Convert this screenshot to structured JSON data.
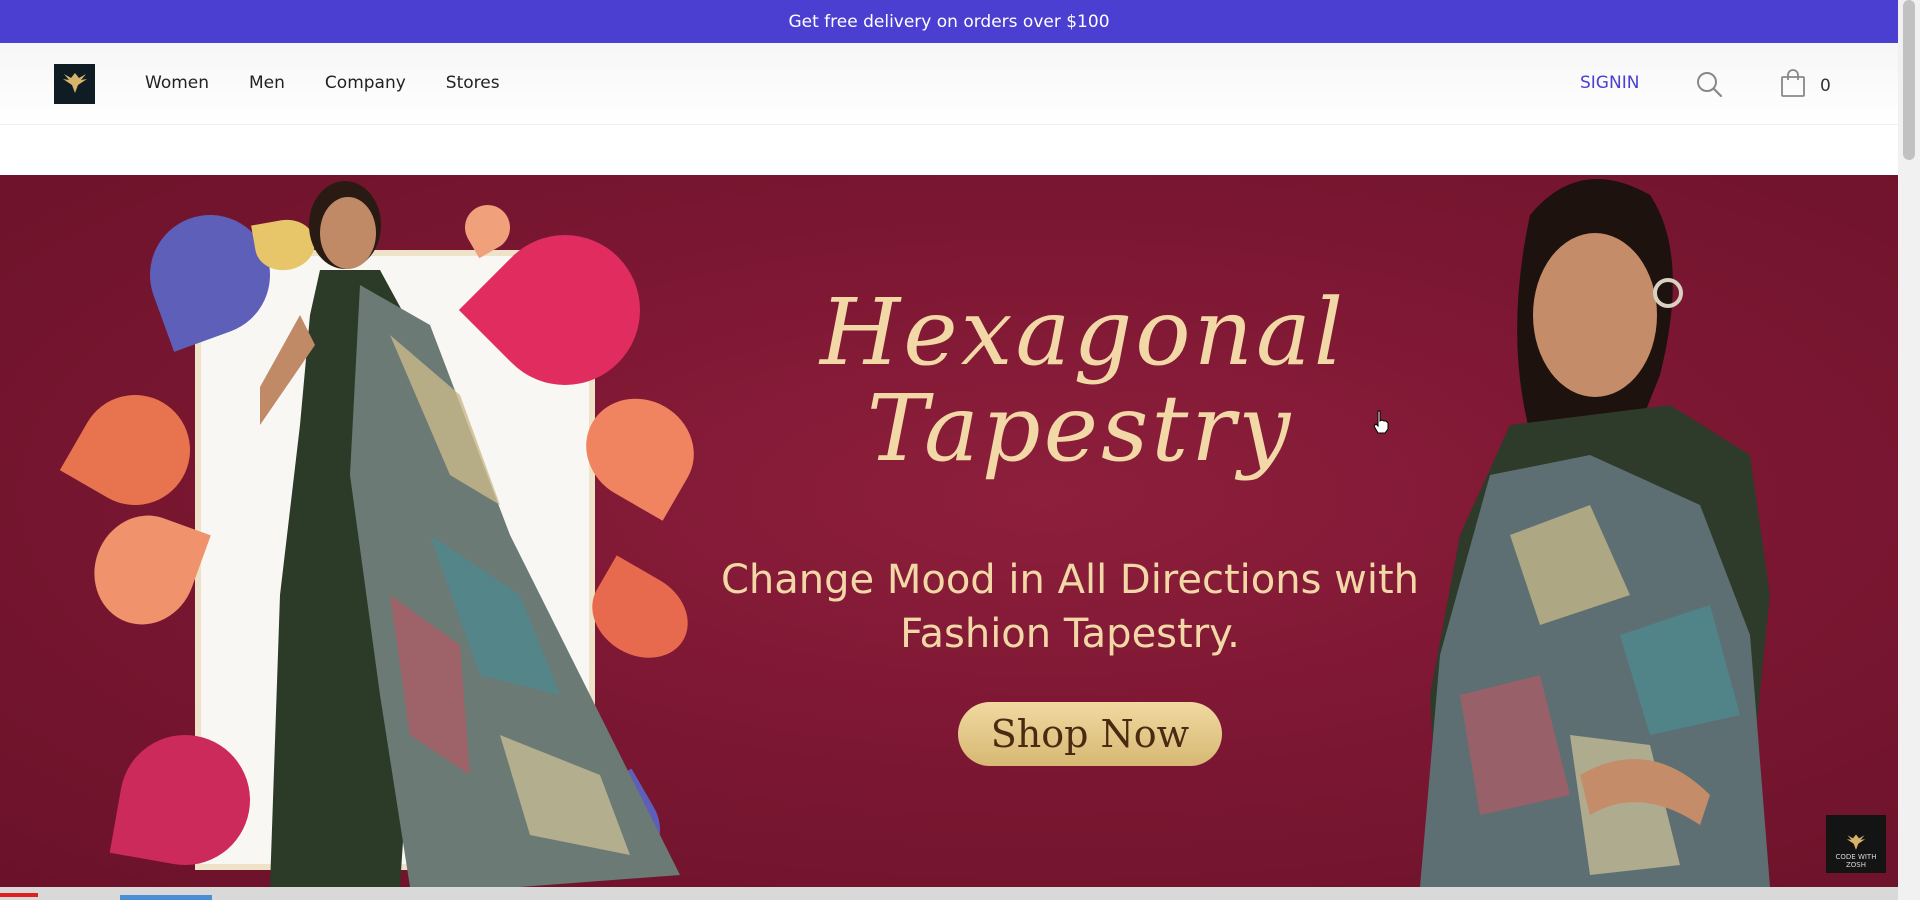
{
  "promo": {
    "text": "Get free delivery on orders over $100"
  },
  "nav": {
    "logo_icon": "eagle-logo-icon",
    "links": [
      "Women",
      "Men",
      "Company",
      "Stores"
    ],
    "signin_label": "SIGNIN",
    "search_icon": "search-icon",
    "cart_icon": "shopping-bag-icon",
    "cart_count": "0"
  },
  "hero": {
    "title_line1": "Hexagonal",
    "title_line2": "Tapestry",
    "subtitle_line1": "Change Mood in All Directions with",
    "subtitle_line2": "Fashion Tapestry.",
    "cta_label": "Shop Now",
    "background_color": "#7d1733",
    "accent_color": "#f2d8a6"
  },
  "watermark": {
    "line1": "CODE WITH",
    "line2": "ZOSH"
  },
  "colors": {
    "primary": "#4a3fd0"
  },
  "video": {
    "progress_fraction": 0.02
  }
}
